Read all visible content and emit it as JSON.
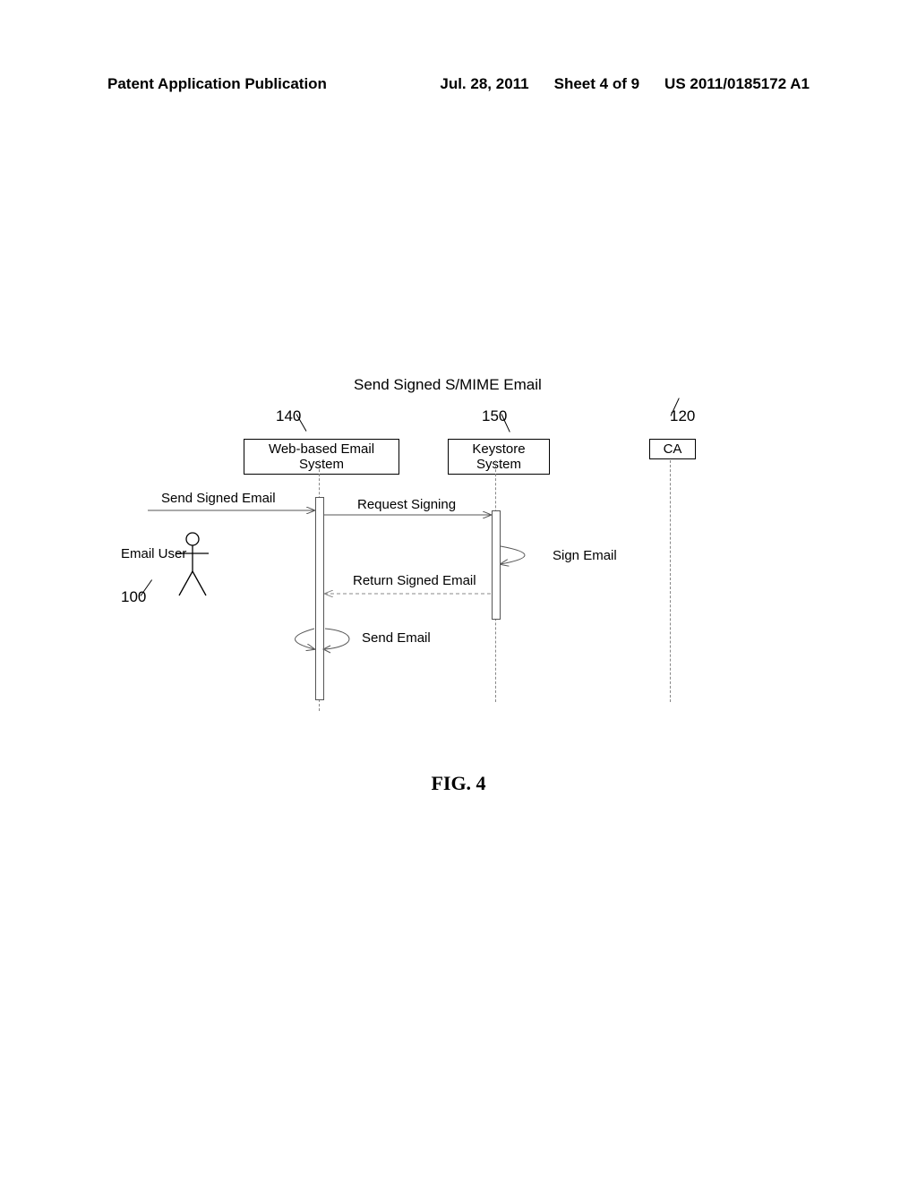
{
  "header": {
    "left": "Patent Application Publication",
    "date": "Jul. 28, 2011",
    "sheet": "Sheet 4 of 9",
    "pubno": "US 2011/0185172 A1"
  },
  "diagram": {
    "title": "Send Signed S/MIME Email",
    "refs": {
      "user": "100",
      "web": "140",
      "keystore": "150",
      "ca": "120"
    },
    "actors": {
      "user": "Email User",
      "web": "Web-based Email System",
      "keystore": "Keystore System",
      "ca": "CA"
    },
    "messages": {
      "m1": "Send Signed Email",
      "m2": "Request Signing",
      "m3": "Sign Email",
      "m4": "Return Signed Email",
      "m5": "Send Email"
    }
  },
  "caption": "FIG. 4"
}
